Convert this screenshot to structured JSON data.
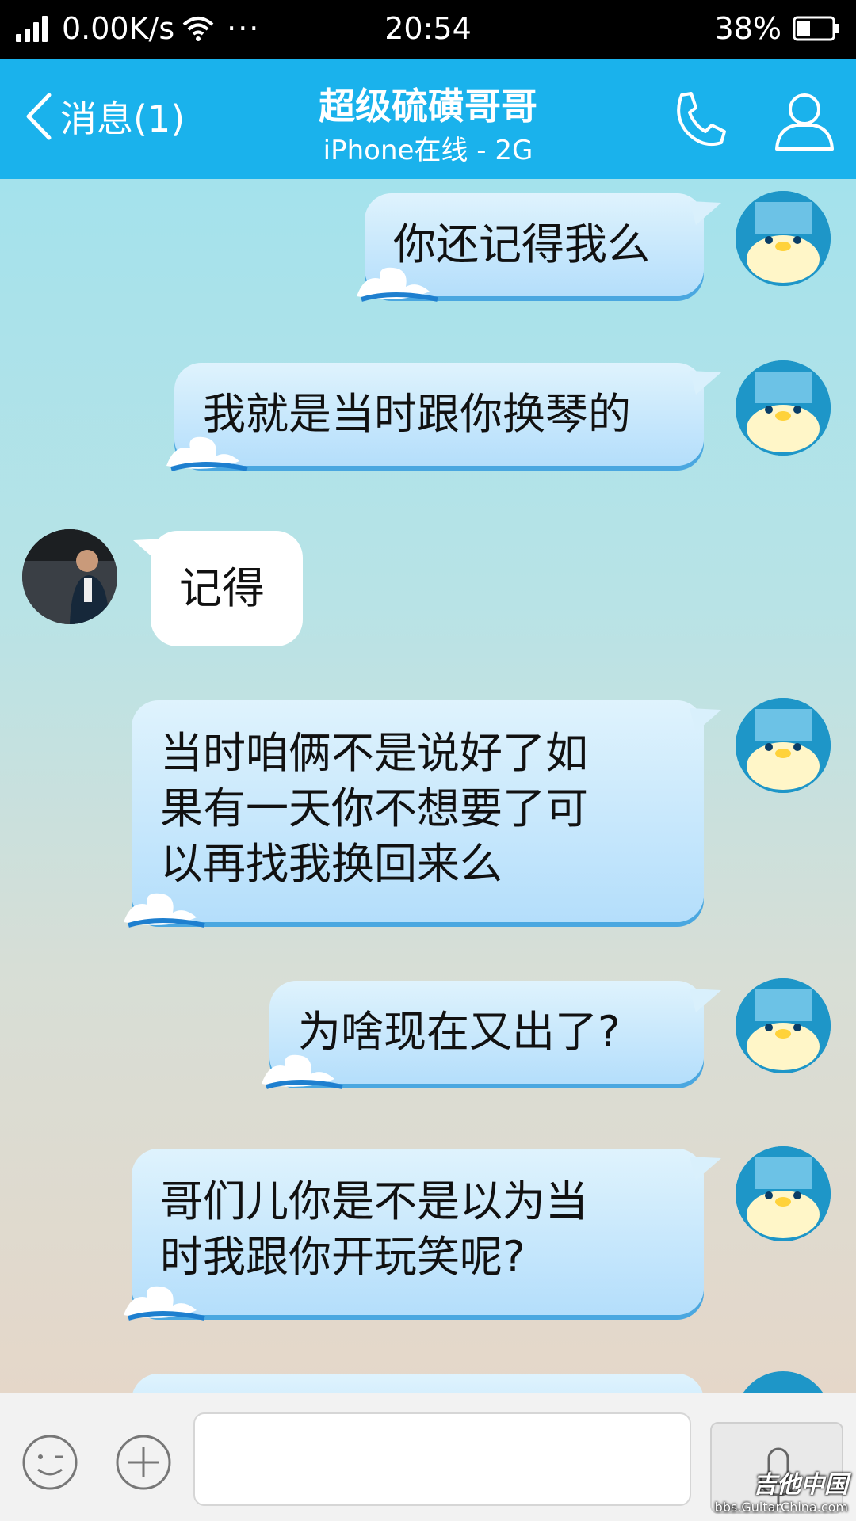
{
  "status_bar": {
    "network_speed": "0.00K/s",
    "more": "···",
    "time": "20:54",
    "battery": "38%",
    "battery_level": 0.38
  },
  "title_bar": {
    "back_label": "消息(1)",
    "contact_name": "超级硫磺哥哥",
    "status": "iPhone在线 - 2G",
    "color": "#1ab2ec"
  },
  "messages": [
    {
      "from": "me",
      "text": "你还记得我么"
    },
    {
      "from": "me",
      "text": "我就是当时跟你换琴的"
    },
    {
      "from": "other",
      "text": "记得"
    },
    {
      "from": "me",
      "lines": [
        "当时咱俩不是说好了如",
        "果有一天你不想要了可",
        "以再找我换回来么"
      ]
    },
    {
      "from": "me",
      "text": "为啥现在又出了?"
    },
    {
      "from": "me",
      "lines": [
        "哥们儿你是不是以为当",
        "时我跟你开玩笑呢?"
      ]
    }
  ],
  "input_bar": {
    "emoji_icon": "emoji-icon",
    "plus_icon": "plus-icon",
    "voice_icon": "microphone-icon",
    "text_value": ""
  },
  "watermark": {
    "title": "吉他中国",
    "url": "bbs.GuitarChina.com"
  }
}
